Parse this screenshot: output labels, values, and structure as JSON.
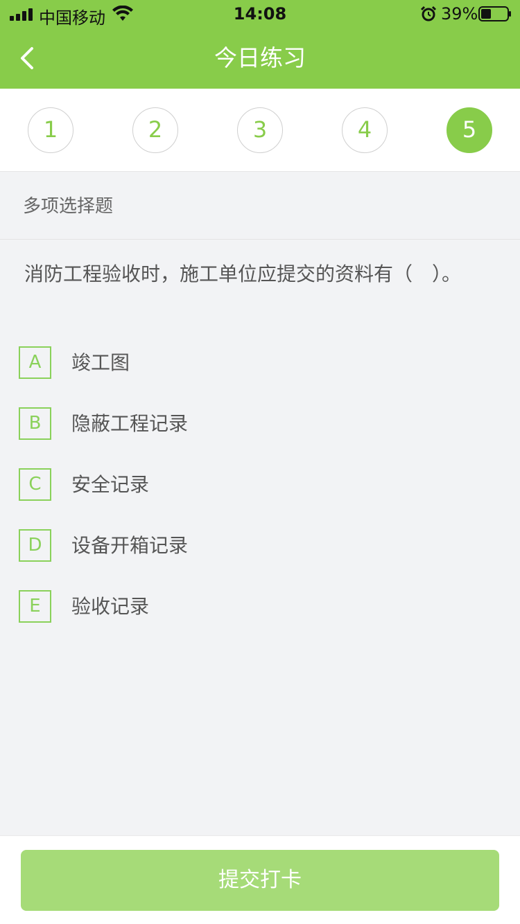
{
  "status_bar": {
    "carrier": "中国移动",
    "time": "14:08",
    "battery_percent": "39%",
    "battery_level": 0.39
  },
  "nav": {
    "title": "今日练习",
    "back_icon": "chevron-left-icon"
  },
  "question_numbers": [
    {
      "label": "1",
      "active": false
    },
    {
      "label": "2",
      "active": false
    },
    {
      "label": "3",
      "active": false
    },
    {
      "label": "4",
      "active": false
    },
    {
      "label": "5",
      "active": true
    }
  ],
  "question": {
    "type_label": "多项选择题",
    "text": "消防工程验收时，施工单位应提交的资料有（　）。",
    "options": [
      {
        "letter": "A",
        "text": "竣工图"
      },
      {
        "letter": "B",
        "text": "隐蔽工程记录"
      },
      {
        "letter": "C",
        "text": "安全记录"
      },
      {
        "letter": "D",
        "text": "设备开箱记录"
      },
      {
        "letter": "E",
        "text": "验收记录"
      }
    ]
  },
  "footer": {
    "submit_label": "提交打卡"
  },
  "colors": {
    "accent": "#88cc4a",
    "submit_button": "#a6db78",
    "background": "#f2f3f5"
  }
}
